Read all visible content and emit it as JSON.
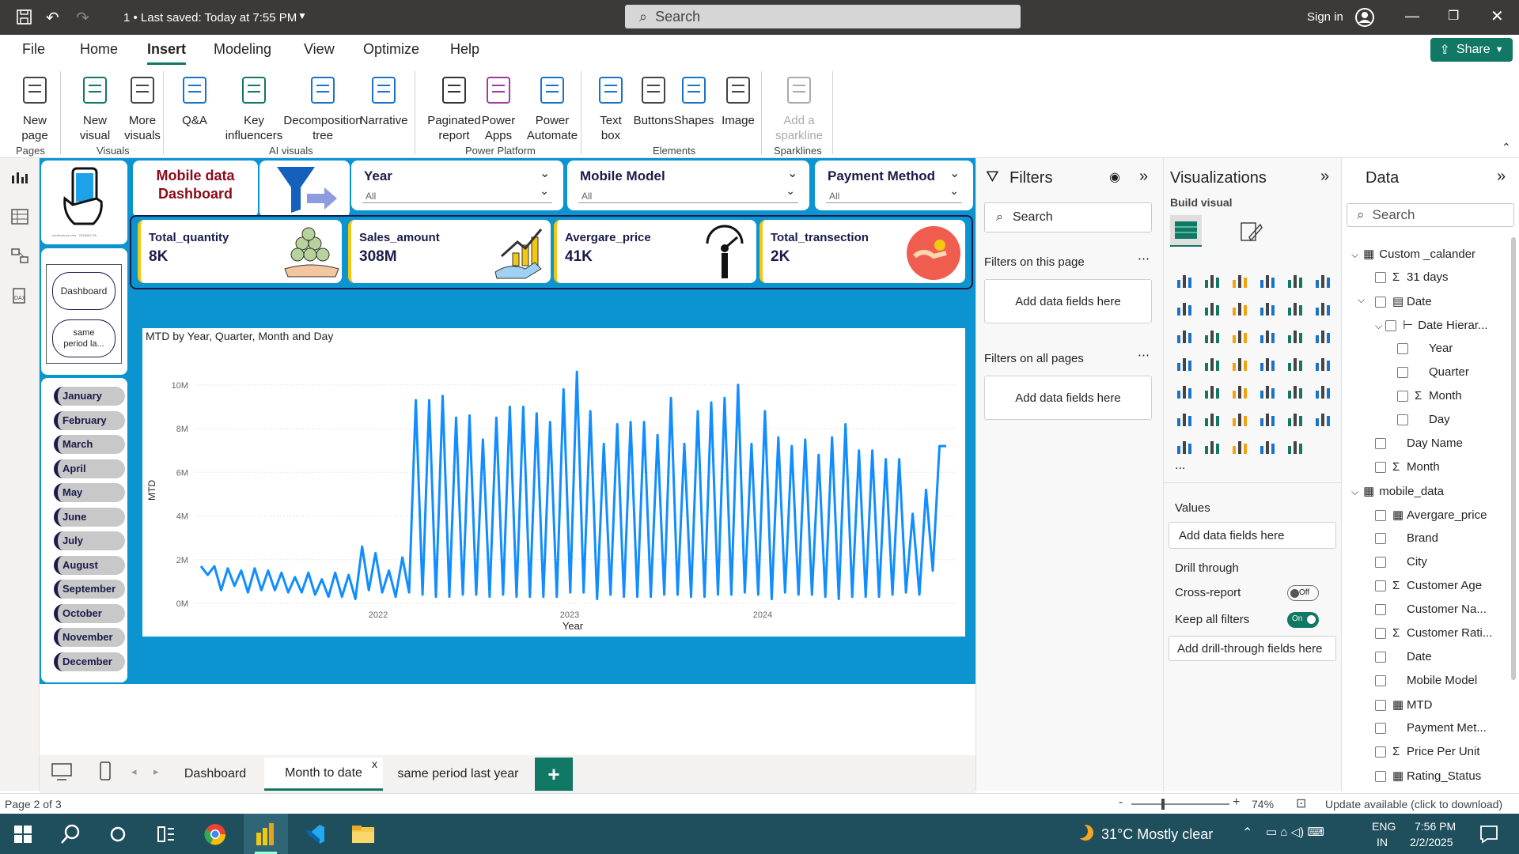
{
  "titlebar": {
    "save_state": "1 • Last saved: Today at 7:55 PM",
    "search_placeholder": "Search",
    "sign_in": "Sign in"
  },
  "menu": {
    "items": [
      "File",
      "Home",
      "Insert",
      "Modeling",
      "View",
      "Optimize",
      "Help"
    ],
    "active": "Insert",
    "share": "Share"
  },
  "ribbon": {
    "buttons": [
      {
        "label": "New\npage",
        "icon": "new-page-icon"
      },
      {
        "label": "New\nvisual",
        "icon": "new-visual-icon"
      },
      {
        "label": "More\nvisuals",
        "icon": "more-visuals-icon"
      },
      {
        "label": "Q&A",
        "icon": "qa-icon"
      },
      {
        "label": "Key\ninfluencers",
        "icon": "key-influencers-icon"
      },
      {
        "label": "Decomposition\ntree",
        "icon": "decomposition-tree-icon"
      },
      {
        "label": "Narrative",
        "icon": "narrative-icon"
      },
      {
        "label": "Paginated\nreport",
        "icon": "paginated-report-icon"
      },
      {
        "label": "Power\nApps",
        "icon": "power-apps-icon"
      },
      {
        "label": "Power\nAutomate",
        "icon": "power-automate-icon"
      },
      {
        "label": "Text\nbox",
        "icon": "text-box-icon"
      },
      {
        "label": "Buttons",
        "icon": "buttons-icon"
      },
      {
        "label": "Shapes",
        "icon": "shapes-icon"
      },
      {
        "label": "Image",
        "icon": "image-icon"
      },
      {
        "label": "Add a\nsparkline",
        "icon": "sparkline-icon"
      }
    ],
    "groups": [
      "Pages",
      "Visuals",
      "AI visuals",
      "Power Platform",
      "Elements",
      "Sparklines"
    ]
  },
  "report": {
    "title": "Mobile data\nDashboard",
    "slicers": [
      {
        "title": "Year",
        "value": "All"
      },
      {
        "title": "Mobile Model",
        "value": "All"
      },
      {
        "title": "Payment Method",
        "value": "All"
      }
    ],
    "kpis": [
      {
        "title": "Total_quantity",
        "value": "8K"
      },
      {
        "title": "Sales_amount",
        "value": "308M"
      },
      {
        "title": "Avergare_price",
        "value": "41K"
      },
      {
        "title": "Total_transection",
        "value": "2K"
      }
    ],
    "nav_buttons": [
      "Dashboard",
      "same\nperiod la..."
    ],
    "months": [
      "January",
      "February",
      "March",
      "April",
      "May",
      "June",
      "July",
      "August",
      "September",
      "October",
      "November",
      "December"
    ],
    "logo_caption": "shutterstock.com · 2348881799"
  },
  "chart_data": {
    "type": "line",
    "title": "MTD by Year, Quarter, Month and Day",
    "xlabel": "Year",
    "ylabel": "MTD",
    "yticks": [
      "0M",
      "2M",
      "4M",
      "6M",
      "8M",
      "10M"
    ],
    "xticks": [
      "2022",
      "2023",
      "2024"
    ],
    "ylim": [
      0,
      10500000
    ],
    "series": [
      {
        "name": "MTD",
        "color": "#118dff",
        "values": [
          1.7,
          1.3,
          1.7,
          0.6,
          1.6,
          0.8,
          1.5,
          0.5,
          1.6,
          0.6,
          1.5,
          0.6,
          1.4,
          0.5,
          1.2,
          0.5,
          1.4,
          0.4,
          1.1,
          0.3,
          1.4,
          0.3,
          1.3,
          0.2,
          2.6,
          0.6,
          2.3,
          0.5,
          1.5,
          0.3,
          2.1,
          0.5,
          9.3,
          0.4,
          9.3,
          0.3,
          9.5,
          0.3,
          8.5,
          0.4,
          8.6,
          0.4,
          7.5,
          0.3,
          8.5,
          0.4,
          9.0,
          0.3,
          9.0,
          0.3,
          8.7,
          0.3,
          8.3,
          0.3,
          9.8,
          0.5,
          10.6,
          0.5,
          8.8,
          0.2,
          7.3,
          0.4,
          8.2,
          0.3,
          8.3,
          0.3,
          8.3,
          0.3,
          7.7,
          0.4,
          9.4,
          0.4,
          7.3,
          0.3,
          8.8,
          0.3,
          9.2,
          0.4,
          9.4,
          0.4,
          10.0,
          0.5,
          7.3,
          0.4,
          8.8,
          0.2,
          7.6,
          0.5,
          7.2,
          0.4,
          7.5,
          0.4,
          6.8,
          0.3,
          7.6,
          0.2,
          8.2,
          0.3,
          7.0,
          0.3,
          7.0,
          0.3,
          6.6,
          0.4,
          6.6,
          0.5,
          4.1,
          0.4,
          5.2,
          1.5,
          7.2,
          7.2
        ]
      }
    ],
    "ylabel_units": "M"
  },
  "tabs": {
    "items": [
      "Dashboard",
      "Month to date",
      "same period last year"
    ],
    "active": "Month to date",
    "add": "+"
  },
  "filters": {
    "title": "Filters",
    "search": "Search",
    "on_page": "Filters on this page",
    "on_all": "Filters on all pages",
    "add_fields": "Add data fields here"
  },
  "visualizations": {
    "title": "Visualizations",
    "build": "Build visual",
    "values": "Values",
    "add_fields": "Add data fields here",
    "drill": "Drill through",
    "cross_report": "Cross-report",
    "cross_state": "Off",
    "keep_filters": "Keep all filters",
    "keep_state": "On",
    "add_drill": "Add drill-through fields here",
    "more": "..."
  },
  "data": {
    "title": "Data",
    "search": "Search",
    "rows": [
      {
        "indent": 0,
        "label": "Custom _calander",
        "kind": "table"
      },
      {
        "indent": 1,
        "label": "31 days",
        "kind": "sigma"
      },
      {
        "indent": 1,
        "label": "Date",
        "kind": "cal"
      },
      {
        "indent": 2,
        "label": "Date Hierar...",
        "kind": "hier"
      },
      {
        "indent": 3,
        "label": "Year",
        "kind": "plain"
      },
      {
        "indent": 3,
        "label": "Quarter",
        "kind": "plain"
      },
      {
        "indent": 3,
        "label": "Month",
        "kind": "sigma"
      },
      {
        "indent": 3,
        "label": "Day",
        "kind": "plain"
      },
      {
        "indent": 1,
        "label": "Day Name",
        "kind": "plain"
      },
      {
        "indent": 1,
        "label": "Month",
        "kind": "sigma"
      },
      {
        "indent": 0,
        "label": "mobile_data",
        "kind": "table"
      },
      {
        "indent": 1,
        "label": "Avergare_price",
        "kind": "calc"
      },
      {
        "indent": 1,
        "label": "Brand",
        "kind": "plain"
      },
      {
        "indent": 1,
        "label": "City",
        "kind": "plain"
      },
      {
        "indent": 1,
        "label": "Customer Age",
        "kind": "sigma"
      },
      {
        "indent": 1,
        "label": "Customer Na...",
        "kind": "plain"
      },
      {
        "indent": 1,
        "label": "Customer Rati...",
        "kind": "sigma"
      },
      {
        "indent": 1,
        "label": "Date",
        "kind": "plain"
      },
      {
        "indent": 1,
        "label": "Mobile Model",
        "kind": "plain"
      },
      {
        "indent": 1,
        "label": "MTD",
        "kind": "calc"
      },
      {
        "indent": 1,
        "label": "Payment Met...",
        "kind": "plain"
      },
      {
        "indent": 1,
        "label": "Price Per Unit",
        "kind": "sigma"
      },
      {
        "indent": 1,
        "label": "Rating_Status",
        "kind": "calc"
      }
    ]
  },
  "status": {
    "page": "Page 2 of 3",
    "zoom": "74%",
    "update": "Update available (click to download)"
  },
  "taskbar": {
    "weather": "31°C  Mostly clear",
    "lang1": "ENG",
    "lang2": "IN",
    "time": "7:56 PM",
    "date": "2/2/2025"
  }
}
